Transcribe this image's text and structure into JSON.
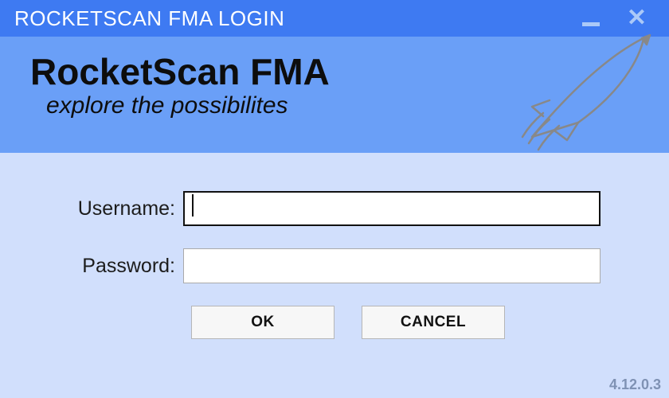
{
  "window": {
    "title": "ROCKETSCAN FMA LOGIN"
  },
  "banner": {
    "product_name": "RocketScan FMA",
    "tagline": "explore the possibilites"
  },
  "form": {
    "username_label": "Username:",
    "username_value": "",
    "password_label": "Password:",
    "password_value": ""
  },
  "buttons": {
    "ok": "OK",
    "cancel": "CANCEL"
  },
  "version": "4.12.0.3",
  "colors": {
    "titlebar": "#3e7af2",
    "banner": "#6a9ff7",
    "body": "#d1dffc"
  }
}
